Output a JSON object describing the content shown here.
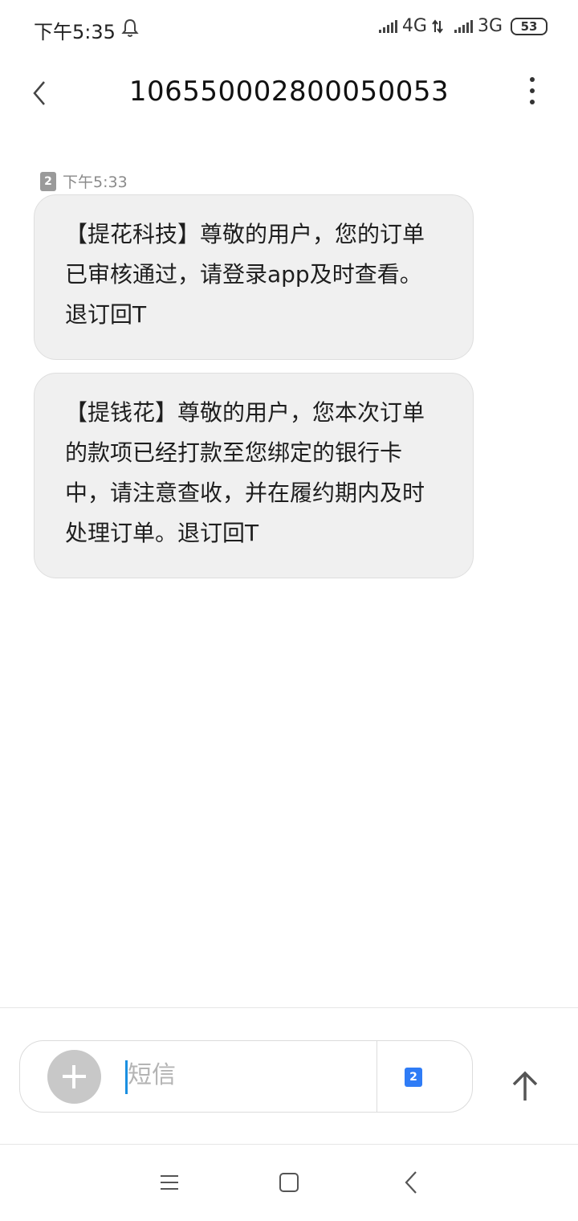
{
  "status_bar": {
    "time": "下午5:35",
    "network_1": "4G",
    "network_2": "3G",
    "battery": "53"
  },
  "header": {
    "title": "106550002800050053"
  },
  "messages": {
    "sim_slot": "2",
    "time": "下午5:33",
    "items": [
      {
        "text": "【提花科技】尊敬的用户，您的订单已审核通过，请登录app及时查看。退订回T"
      },
      {
        "text": "【提钱花】尊敬的用户，您本次订单的款项已经打款至您绑定的银行卡中，请注意查收，并在履约期内及时处理订单。退订回T"
      }
    ]
  },
  "composer": {
    "placeholder": "短信",
    "sim_slot": "2"
  },
  "icons": {
    "bell": "bell-icon",
    "back": "back-arrow-icon",
    "more": "more-vertical-icon",
    "add": "plus-icon",
    "send": "send-up-arrow-icon",
    "nav_menu": "menu-icon",
    "nav_home": "home-square-icon",
    "nav_back": "nav-back-icon"
  },
  "colors": {
    "bubble_bg": "#f0f0f0",
    "accent": "#2f7cf6",
    "cursor": "#1a8fe0"
  }
}
